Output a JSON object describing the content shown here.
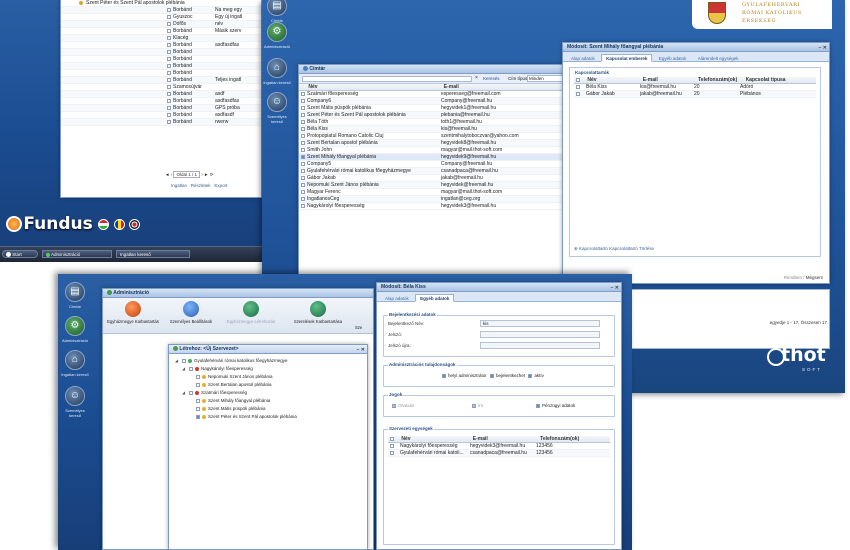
{
  "back_left": {
    "rows": [
      {
        "c1": "Szent Péter és Szent Pál apostolok plébánia",
        "c2": "",
        "c3": ""
      },
      {
        "c1": "",
        "c2": "Borbánd",
        "c3": "Na meg egy"
      },
      {
        "c1": "",
        "c2": "Gyuszoc",
        "c3": "Egy új ingatl"
      },
      {
        "c1": "",
        "c2": "Dófős",
        "c3": "név"
      },
      {
        "c1": "",
        "c2": "Borbánd",
        "c3": "Másik szerv"
      },
      {
        "c1": "",
        "c2": "Klacég",
        "c3": ""
      },
      {
        "c1": "",
        "c2": "Borbánd",
        "c3": "asdfasdfas"
      },
      {
        "c1": "",
        "c2": "Borbánd",
        "c3": ""
      },
      {
        "c1": "",
        "c2": "Borbánd",
        "c3": ""
      },
      {
        "c1": "",
        "c2": "Borbánd",
        "c3": ""
      },
      {
        "c1": "",
        "c2": "Borbánd",
        "c3": ""
      },
      {
        "c1": "",
        "c2": "Borbánd",
        "c3": "Teljes ingatl"
      },
      {
        "c1": "",
        "c2": "Szamosújvár",
        "c3": ""
      },
      {
        "c1": "",
        "c2": "Borbánd",
        "c3": "asdf"
      },
      {
        "c1": "",
        "c2": "Borbánd",
        "c3": "asdfasdfas"
      },
      {
        "c1": "",
        "c2": "Borbánd",
        "c3": "GPS próba"
      },
      {
        "c1": "",
        "c2": "Borbánd",
        "c3": "asdfasdf"
      },
      {
        "c1": "",
        "c2": "Borbánd",
        "c3": "rwerw"
      }
    ],
    "pager": "Oldal  1  / 1",
    "footer_links": [
      "Ingatlan",
      "Részletek",
      "Export"
    ],
    "side_icons": [
      "Címtár",
      "Adminisztráció"
    ],
    "brand": "Fundus",
    "start_label": "Start",
    "task_items": [
      "Adminisztráció",
      "Ingatlan kereső"
    ]
  },
  "back_right": {
    "logo_text": [
      "GYULAFEHÉRVÁRI",
      "RÓMAI KATOLIKUS",
      "ÉRSEKSÉG"
    ],
    "side_icons": [
      "Címtár",
      "Adminisztráció",
      "Ingatlan kereső",
      "Személyes kereső"
    ],
    "cimtar": {
      "title": "Címtár",
      "search_label": "Keresés",
      "type_label": "Cím típus",
      "type_value": "Minden",
      "columns": [
        "Név",
        "E-mail"
      ],
      "rows": [
        {
          "name": "Szatmári főesperesség",
          "email": "esperesseg@freemail.com"
        },
        {
          "name": "Company6",
          "email": "Company@freemail.hu"
        },
        {
          "name": "Szent Mátis püspök plébánia",
          "email": "hegyvidek1@freemail.hu"
        },
        {
          "name": "Szent Péter és Szent Pál apostolok plébánia",
          "email": "plebania@freemail.hu"
        },
        {
          "name": "Béla Tóth",
          "email": "toth1@freemail.hu"
        },
        {
          "name": "Béla Kiss",
          "email": "kis@freemail.hu"
        },
        {
          "name": "Protopopiatul Romano Catolic Cluj",
          "email": "szentmihalytoboczvar@yahoo.com"
        },
        {
          "name": "Szent Bertalan apostol plébánia",
          "email": "hegyvidek8@freemail.hu"
        },
        {
          "name": "Smith John",
          "email": "magyar@mail.thot-soft.com"
        },
        {
          "name": "Szent Mihály főangyal plébánia",
          "email": "hegyvidek9@freemail.hu"
        },
        {
          "name": "Company5",
          "email": "Company@freemail.hu"
        },
        {
          "name": "Gyulafehérvári római katolikus főegyházmegye",
          "email": "csanadpaca@freemail.hu"
        },
        {
          "name": "Gábor Jakab",
          "email": "jakab@freemail.hu"
        },
        {
          "name": "Nepomuki Szent János plébánia",
          "email": "hegyvidek@freemail.hu"
        },
        {
          "name": "Magyar Ferenc",
          "email": "magyar@mail.thot-soft.com"
        },
        {
          "name": "IngatlanosCeg",
          "email": "ingatlan@ceg.org"
        },
        {
          "name": "Nagykárolyi főesperesség",
          "email": "hegyvidek3@freemail.hu"
        }
      ]
    },
    "detail": {
      "title": "Módosít: Szent Mihály főangyal plébánia",
      "tabs": [
        "Alap adatok",
        "Kapcsolat emberek",
        "Egyéb adatok",
        "Alárendelt egységek"
      ],
      "section": "Kapcsolattartók",
      "columns": [
        "Név",
        "E-mail",
        "Telefonszám(ok)",
        "Kapcsolat típusa"
      ],
      "rows": [
        {
          "name": "Béla Kiss",
          "email": "kis@freemail.hu",
          "phone": "20",
          "type": "Adóró"
        },
        {
          "name": "Gábor Jakab",
          "email": "jakab@freemail.hu",
          "phone": "20",
          "type": "Plébános"
        }
      ],
      "footer": "Kapcsolattartó  Kapcsolattartó Törlése",
      "buttons": [
        "Rendben",
        "Mégsem"
      ]
    },
    "bottom_text": "egyedje 1 - 17, Összesen 17",
    "brand_thot": "thot",
    "brand_soft": "SOFT"
  },
  "front": {
    "side_icons": [
      "Címtár",
      "Adminisztráció",
      "Ingatlan kereső",
      "Személyes kereső"
    ],
    "admin": {
      "title": "Adminisztráció",
      "tools": [
        "Egyházmegye Karbantartás",
        "Személyes Beállítások",
        "Egyházmegye Létrehozás",
        "Szerelések Karbantartása",
        "Sze"
      ]
    },
    "tree": {
      "title": "Létrehoz: <Új Szervezet>",
      "nodes": [
        {
          "label": "Gyulafehérvári római katolikus főegyházmegye",
          "level": 0,
          "checked": false
        },
        {
          "label": "Nagykárolyi főesperesség",
          "level": 1,
          "checked": false
        },
        {
          "label": "Nepomuki Szent János plébánia",
          "level": 2,
          "checked": false
        },
        {
          "label": "Szent Bertalan apostol plébánia",
          "level": 2,
          "checked": false
        },
        {
          "label": "Szatmári főesperesség",
          "level": 1,
          "checked": false
        },
        {
          "label": "Szent Mihály főangyal plébánia",
          "level": 2,
          "checked": false
        },
        {
          "label": "Szent Mátis püspök plébánia",
          "level": 2,
          "checked": false
        },
        {
          "label": "Szent Péter és Szent Pál apostolok plébánia",
          "level": 2,
          "checked": true
        }
      ]
    },
    "user": {
      "title": "Módosít: Béla Kiss",
      "tabs": [
        "Alap adatok",
        "Egyéb adatok"
      ],
      "login_legend": "Bejelentkezési adatok",
      "login_name_label": "Bejelentkező Név:",
      "login_name_value": "kis",
      "password_label": "Jelszó:",
      "password2_label": "Jelszó újra:",
      "admin_legend": "Adminisztrációs tulajdonságok",
      "admin_checks": [
        "helyi adminisztrátor",
        "bejelentkezhet",
        "aktív"
      ],
      "rights_legend": "Jogok",
      "rights": [
        "Olvasás",
        "Író",
        "Pénzügyi adatok"
      ],
      "units_legend": "Szervezeti egységek",
      "units_columns": [
        "Név",
        "E-mail",
        "Telefonszám(ok)"
      ],
      "units_rows": [
        {
          "name": "Nagykárolyi főesperesség",
          "email": "hegyvidek3@freemail.hu",
          "phone": "123456"
        },
        {
          "name": "Gyulafehérvári római katoli...",
          "email": "csanadpaca@freemail.hu",
          "phone": "123456"
        }
      ]
    }
  },
  "colors": {
    "accent": "#2a5fa4",
    "brand_orange": "#f08a1c",
    "title_blue": "#15325a"
  }
}
